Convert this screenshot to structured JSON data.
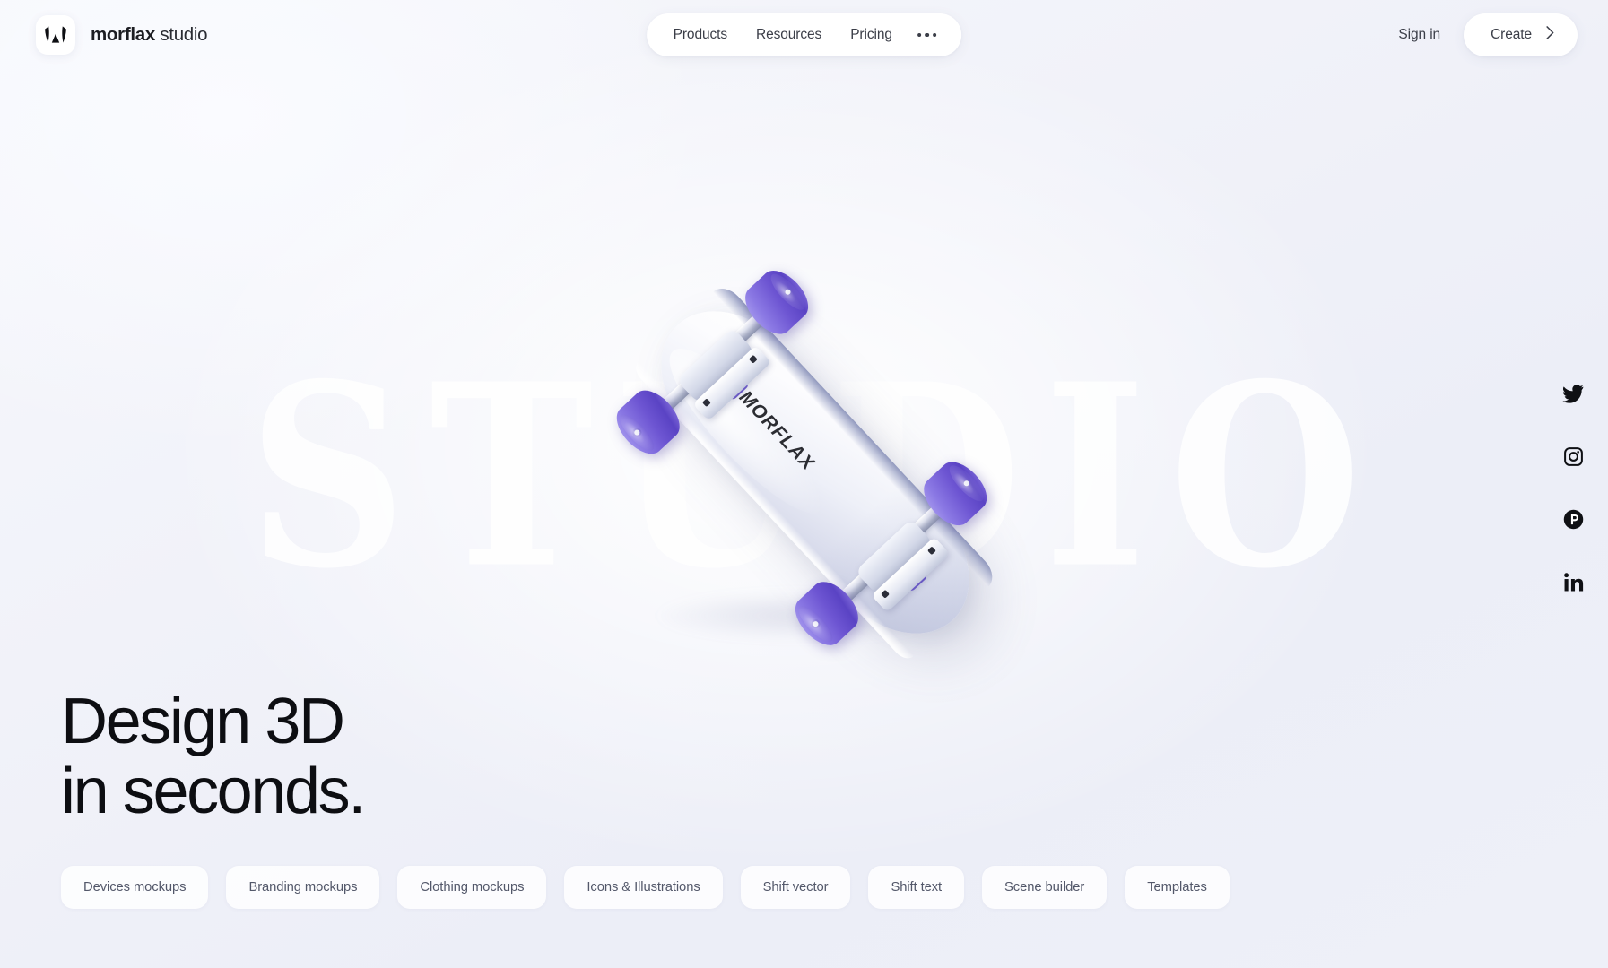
{
  "brand": {
    "logo_icon": "morflax-mark-icon",
    "name_strong": "morflax",
    "name_light": " studio"
  },
  "nav": {
    "items": [
      {
        "label": "Products"
      },
      {
        "label": "Resources"
      },
      {
        "label": "Pricing"
      }
    ],
    "more_icon": "ellipsis-icon"
  },
  "header_actions": {
    "sign_in_label": "Sign in",
    "create_label": "Create",
    "create_chevron_icon": "chevron-right-icon"
  },
  "hero": {
    "watermark": "STUDIO",
    "title_line1": "Design 3D",
    "title_line2": "in seconds.",
    "board_logo": "MORFLAX"
  },
  "chips": [
    {
      "label": "Devices mockups"
    },
    {
      "label": "Branding mockups"
    },
    {
      "label": "Clothing mockups"
    },
    {
      "label": "Icons & Illustrations"
    },
    {
      "label": "Shift vector"
    },
    {
      "label": "Shift text"
    },
    {
      "label": "Scene builder"
    },
    {
      "label": "Templates"
    }
  ],
  "social": [
    {
      "name": "twitter",
      "icon": "twitter-icon"
    },
    {
      "name": "instagram",
      "icon": "instagram-icon"
    },
    {
      "name": "producthunt",
      "icon": "producthunt-icon"
    },
    {
      "name": "linkedin",
      "icon": "linkedin-icon"
    }
  ],
  "colors": {
    "background_start": "#f7f8fc",
    "background_end": "#eceef8",
    "accent_purple": "#6d55d2",
    "accent_purple_light": "#a79aee",
    "text_dark": "#0d0e12",
    "text_muted": "#53586a",
    "surface_white": "#ffffff"
  }
}
